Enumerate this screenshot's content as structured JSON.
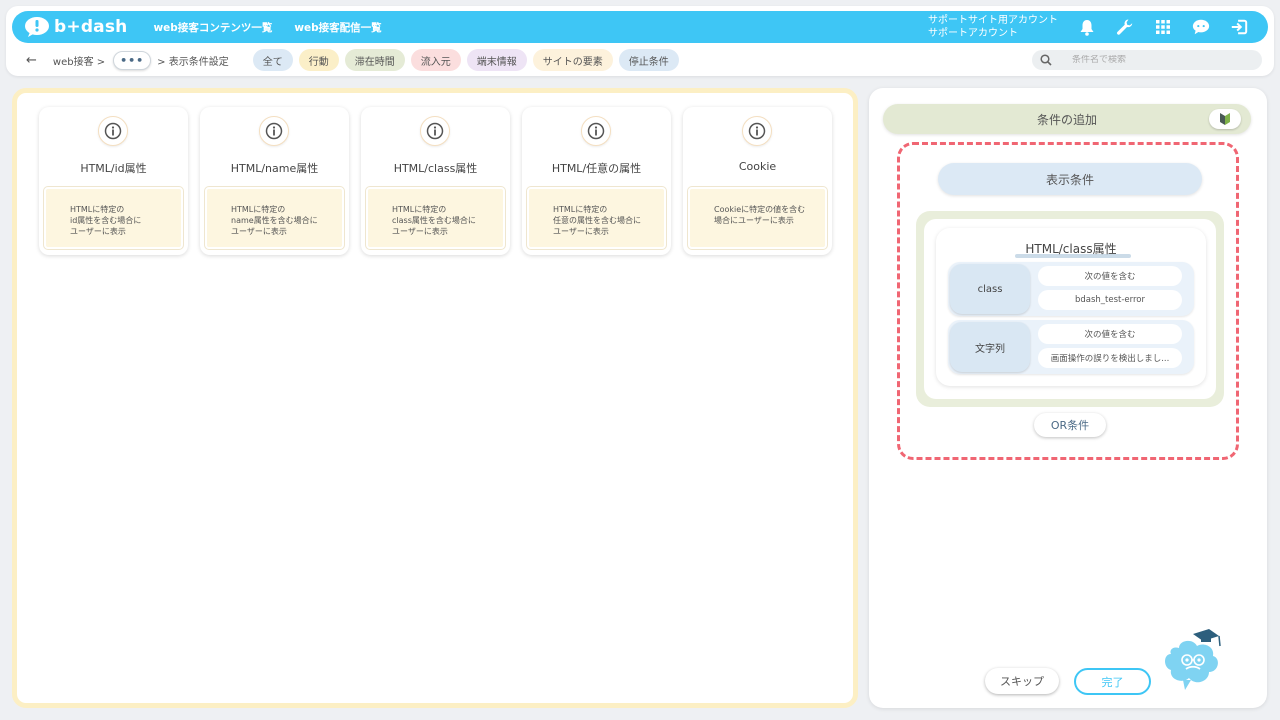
{
  "header": {
    "logo_text": "b+dash",
    "nav": [
      "web接客コンテンツ一覧",
      "web接客配信一覧"
    ],
    "account_line1": "サポートサイト用アカウント",
    "account_line2": "サポートアカウント",
    "icons": [
      "bell-icon",
      "wrench-icon",
      "grid-icon",
      "chat-icon",
      "logout-icon"
    ],
    "brand_color": "#3ec6f5"
  },
  "breadcrumb": {
    "back": "←",
    "root": "web接客 >",
    "ellipsis": "•••",
    "current": "> 表示条件設定"
  },
  "filters": [
    {
      "label": "全て",
      "color": "#dce9f5"
    },
    {
      "label": "行動",
      "color": "#fbefc8"
    },
    {
      "label": "滞在時間",
      "color": "#e5ebd6"
    },
    {
      "label": "流入元",
      "color": "#fbdede"
    },
    {
      "label": "端末情報",
      "color": "#eee4f5"
    },
    {
      "label": "サイトの要素",
      "color": "#fdf2dc"
    },
    {
      "label": "停止条件",
      "color": "#dce9f5"
    }
  ],
  "search": {
    "placeholder": "条件名で検索"
  },
  "cards": [
    {
      "title": "HTML/id属性",
      "desc": "HTMLに特定の\nid属性を含む場合に\nユーザーに表示"
    },
    {
      "title": "HTML/name属性",
      "desc": "HTMLに特定の\nname属性を含む場合に\nユーザーに表示"
    },
    {
      "title": "HTML/class属性",
      "desc": "HTMLに特定の\nclass属性を含む場合に\nユーザーに表示"
    },
    {
      "title": "HTML/任意の属性",
      "desc": "HTMLに特定の\n任意の属性を含む場合に\nユーザーに表示"
    },
    {
      "title": "Cookie",
      "desc": "Cookieに特定の値を含む\n場合にユーザーに表示"
    }
  ],
  "right": {
    "add_label": "条件の追加",
    "display_label": "表示条件",
    "condition": {
      "title": "HTML/class属性",
      "rows": [
        {
          "label": "class",
          "op": "次の値を含む",
          "value": "bdash_test-error"
        },
        {
          "label": "文字列",
          "op": "次の値を含む",
          "value": "画面操作の誤りを検出しまし..."
        }
      ]
    },
    "or_label": "OR条件",
    "skip_label": "スキップ",
    "done_label": "完了"
  }
}
